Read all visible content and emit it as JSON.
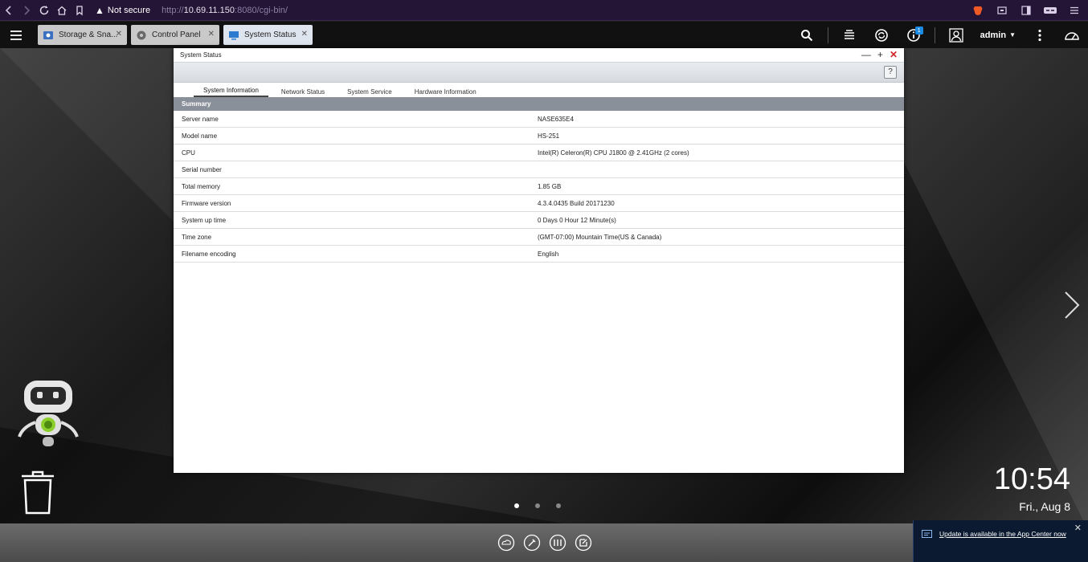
{
  "browser": {
    "security_label": "Not secure",
    "url_scheme": "http://",
    "url_host": "10.69.11.150",
    "url_rest": ":8080/cgi-bin/"
  },
  "topbar": {
    "tabs": [
      {
        "label": "Storage & Sna..."
      },
      {
        "label": "Control Panel"
      },
      {
        "label": "System Status"
      }
    ],
    "user": "admin",
    "notification_count": "1"
  },
  "window": {
    "title": "System Status",
    "help_label": "?",
    "tabs": [
      "System Information",
      "Network Status",
      "System Service",
      "Hardware Information"
    ],
    "section_header": "Summary",
    "rows": [
      {
        "key": "Server name",
        "value": "NASE635E4"
      },
      {
        "key": "Model name",
        "value": "HS-251"
      },
      {
        "key": "CPU",
        "value": "Intel(R) Celeron(R) CPU J1800 @ 2.41GHz (2 cores)"
      },
      {
        "key": "Serial number",
        "value": ""
      },
      {
        "key": "Total memory",
        "value": "1.85 GB"
      },
      {
        "key": "Firmware version",
        "value": "4.3.4.0435 Build 20171230"
      },
      {
        "key": "System up time",
        "value": "0 Days 0 Hour 12 Minute(s)"
      },
      {
        "key": "Time zone",
        "value": "(GMT-07:00) Mountain Time(US & Canada)"
      },
      {
        "key": "Filename encoding",
        "value": "English"
      }
    ]
  },
  "desktop": {
    "time": "10:54",
    "date": "Fri., Aug 8"
  },
  "notification": {
    "message": "Update is available in the App Center now"
  },
  "colors": {
    "browser_bar": "#241436",
    "topbar": "#111111",
    "summary_bar": "#8a9099",
    "close_red": "#d0262a",
    "badge_blue": "#1a8be0"
  }
}
